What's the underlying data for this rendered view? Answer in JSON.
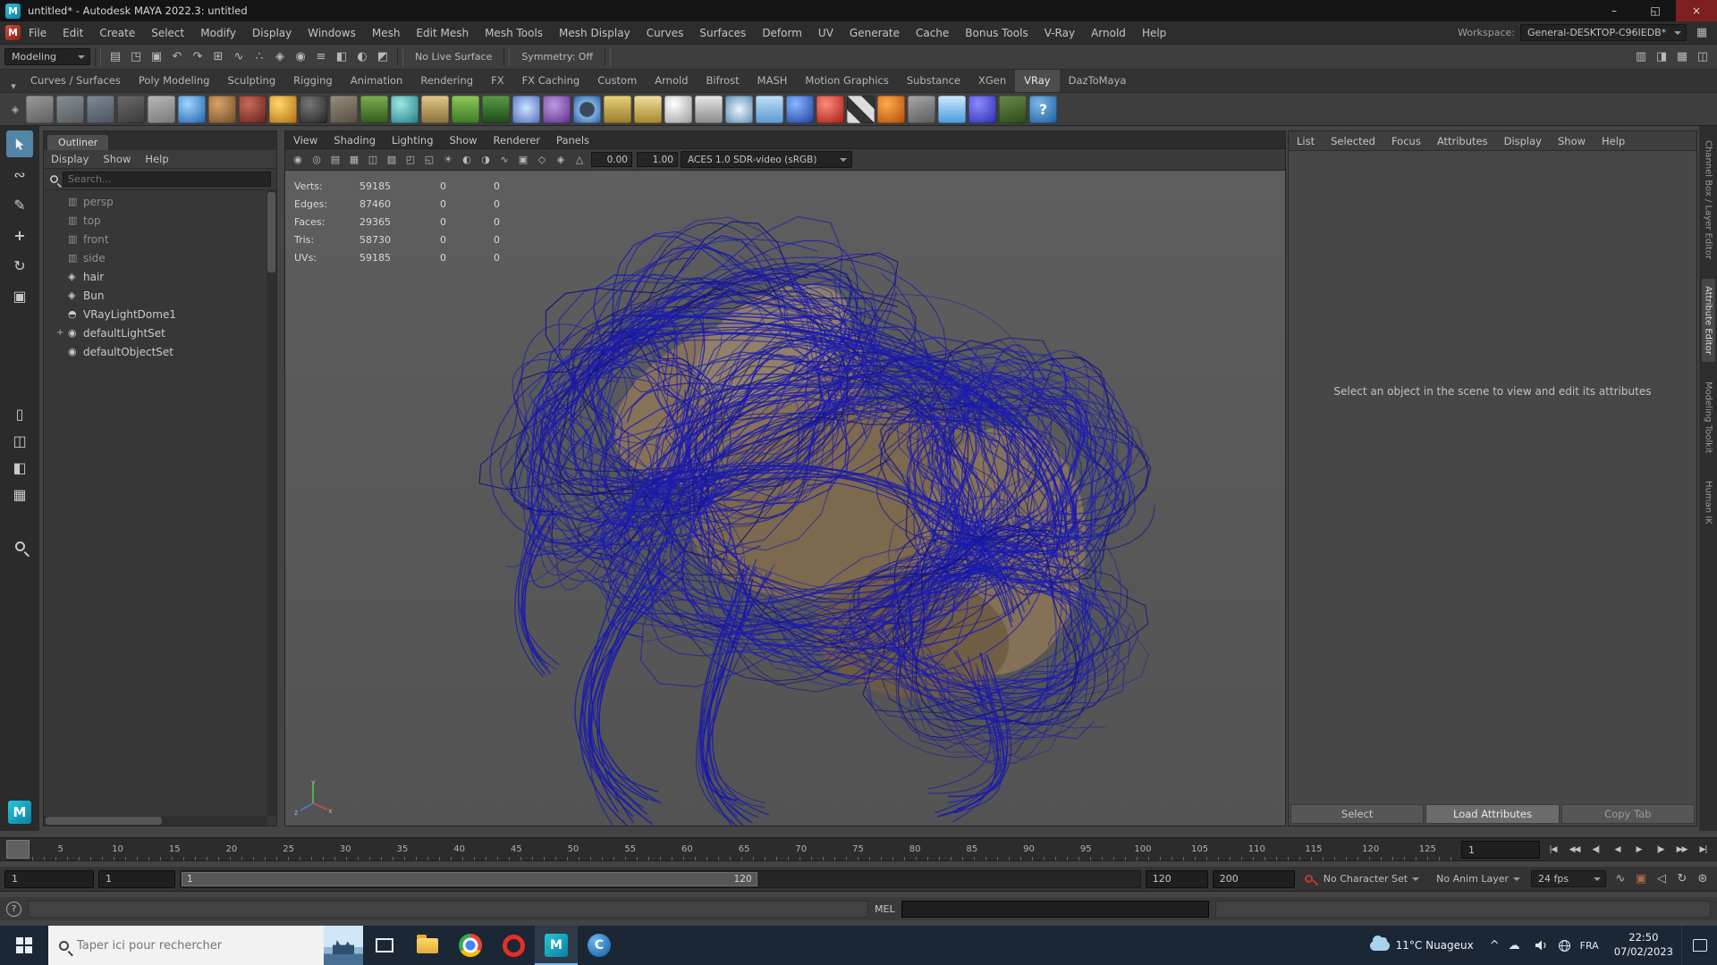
{
  "window": {
    "title": "untitled* - Autodesk MAYA 2022.3: untitled",
    "controls": [
      {
        "glyph": "–",
        "name": "minimize-button"
      },
      {
        "glyph": "◱",
        "name": "maximize-button"
      },
      {
        "glyph": "×",
        "name": "close-button"
      }
    ]
  },
  "logos": {
    "maya": "M",
    "c": "C"
  },
  "menubar": {
    "items": [
      "File",
      "Edit",
      "Create",
      "Select",
      "Modify",
      "Display",
      "Windows",
      "Mesh",
      "Edit Mesh",
      "Mesh Tools",
      "Mesh Display",
      "Curves",
      "Surfaces",
      "Deform",
      "UV",
      "Generate",
      "Cache",
      "Bonus Tools",
      "V-Ray",
      "Arnold",
      "Help"
    ],
    "workspace_label": "Workspace:",
    "workspace_value": "General-DESKTOP-C96IEDB*"
  },
  "statusline": {
    "mode": "Modeling",
    "icons_left": [
      {
        "glyph": "▤",
        "name": "new-scene-icon"
      },
      {
        "glyph": "◳",
        "name": "open-scene-icon"
      },
      {
        "glyph": "▣",
        "name": "save-scene-icon"
      },
      {
        "glyph": "↶",
        "name": "undo-icon"
      },
      {
        "glyph": "↷",
        "name": "redo-icon"
      },
      {
        "glyph": "⊞",
        "name": "snap-to-grid-icon"
      },
      {
        "glyph": "∿",
        "name": "snap-to-curve-icon"
      },
      {
        "glyph": "∴",
        "name": "snap-to-point-icon"
      },
      {
        "glyph": "◈",
        "name": "snap-to-plane-icon"
      },
      {
        "glyph": "◉",
        "name": "make-live-icon"
      },
      {
        "glyph": "≡",
        "name": "construction-history-icon"
      },
      {
        "glyph": "◧",
        "name": "render-icon"
      },
      {
        "glyph": "◐",
        "name": "ipr-render-icon"
      },
      {
        "glyph": "◩",
        "name": "render-settings-icon"
      }
    ],
    "no_live_surface": "No Live Surface",
    "symmetry": "Symmetry: Off",
    "icons_right": [
      {
        "glyph": "▥",
        "name": "sidebar-toggle-icon"
      },
      {
        "glyph": "◨",
        "name": "channel-box-toggle-icon"
      },
      {
        "glyph": "▦",
        "name": "modeling-toolkit-toggle-icon"
      },
      {
        "glyph": "◫",
        "name": "attribute-editor-toggle-icon"
      }
    ]
  },
  "shelf": {
    "tab_selector_glyph": "▾",
    "gear_glyph": "◈",
    "tabs": [
      {
        "label": "Curves / Surfaces"
      },
      {
        "label": "Poly Modeling"
      },
      {
        "label": "Sculpting"
      },
      {
        "label": "Rigging"
      },
      {
        "label": "Animation"
      },
      {
        "label": "Rendering"
      },
      {
        "label": "FX"
      },
      {
        "label": "FX Caching"
      },
      {
        "label": "Custom"
      },
      {
        "label": "Arnold"
      },
      {
        "label": "Bifrost"
      },
      {
        "label": "MASH"
      },
      {
        "label": "Motion Graphics"
      },
      {
        "label": "Substance"
      },
      {
        "label": "XGen"
      },
      {
        "label": "VRay",
        "bg": "#4d4d4d",
        "color": "#e9e9e9"
      },
      {
        "label": "DazToMaya"
      }
    ],
    "icons": [
      {
        "name": "poly-plane-icon",
        "bg": "linear-gradient(160deg,#9a9a9a,#5f5f5f)"
      },
      {
        "name": "uv-grid-icon",
        "bg": "linear-gradient(160deg,#8a8f94,#565b60)"
      },
      {
        "name": "panel-layout-icon",
        "bg": "linear-gradient(160deg,#7f8a94,#4a545e)"
      },
      {
        "name": "dropper-icon",
        "bg": "linear-gradient(160deg,#6a6a6a,#3a3a3a)"
      },
      {
        "name": "notes-icon",
        "bg": "linear-gradient(160deg,#b9b9b9,#787878)"
      },
      {
        "name": "earth-sphere-icon",
        "bg": "radial-gradient(circle at 35% 30%,#9fd4ff,#1d5fa8)"
      },
      {
        "name": "bronze-sphere-icon",
        "bg": "radial-gradient(circle at 35% 30%,#d8a46a,#6e4a22)"
      },
      {
        "name": "maroon-sphere-icon",
        "bg": "radial-gradient(circle at 35% 30%,#c86a5a,#5e1f18)"
      },
      {
        "name": "sun-sphere-icon",
        "bg": "radial-gradient(circle at 35% 30%,#ffd96a,#b06a10)"
      },
      {
        "name": "eclipse-sphere-icon",
        "bg": "radial-gradient(circle at 35% 30%,#777777,#222222)"
      },
      {
        "name": "rock-icon",
        "bg": "linear-gradient(160deg,#9a8f80,#544c40)"
      },
      {
        "name": "tree-icon",
        "bg": "linear-gradient(180deg,#7fae4f,#2e5a1f)"
      },
      {
        "name": "checker-sphere-icon",
        "bg": "radial-gradient(circle at 35% 30%,#9fe8e0,#1f7a8a)"
      },
      {
        "name": "straw-icon",
        "bg": "linear-gradient(180deg,#e0c98a,#8a6f3a)"
      },
      {
        "name": "grass-icon",
        "bg": "linear-gradient(180deg,#8fca5a,#3a7a22)"
      },
      {
        "name": "fern-icon",
        "bg": "linear-gradient(180deg,#5a9a4a,#1e4a18)"
      },
      {
        "name": "flower-icon",
        "bg": "radial-gradient(circle at 50% 45%,#cfe4ff,#4a6ab8)"
      },
      {
        "name": "swirl-icon",
        "bg": "radial-gradient(circle at 40% 35%,#c09ae0,#5a2a8a)"
      },
      {
        "name": "ring-icon",
        "bg": "radial-gradient(circle at 50% 50%,#3a4a5a 35%,#7ab0e0 42%,#2a5a9a)"
      },
      {
        "name": "dome-light-icon",
        "bg": "linear-gradient(180deg,#e8d27a,#9a7a2a)"
      },
      {
        "name": "glass-icon",
        "bg": "linear-gradient(180deg,#f0e0a0,#a8862a)"
      },
      {
        "name": "white-sphere-icon",
        "bg": "radial-gradient(circle at 35% 30%,#ffffff,#9a9a9a)"
      },
      {
        "name": "cone-icon",
        "bg": "linear-gradient(180deg,#e8e8e8,#8a8a8a)"
      },
      {
        "name": "snowflake-icon",
        "bg": "radial-gradient(circle at 50% 50%,#eaf6ff,#5a8ab0)"
      },
      {
        "name": "sky-icon",
        "bg": "linear-gradient(180deg,#bfe0f8,#5a9ad0)"
      },
      {
        "name": "blue-sphere-icon",
        "bg": "radial-gradient(circle at 35% 30%,#8ab8ff,#1a3a9a)"
      },
      {
        "name": "checker-ball-icon",
        "bg": "radial-gradient(circle at 35% 30%,#ff8a7a,#a01a10)"
      },
      {
        "name": "checker-bw-icon",
        "bg": "linear-gradient(45deg,#dddddd 25%,#333333 25% 50%,#dddddd 50% 75%,#333333 75%)"
      },
      {
        "name": "orange-ball-icon",
        "bg": "radial-gradient(circle at 35% 30%,#ffaa4a,#b04a08)"
      },
      {
        "name": "wrench-icon",
        "bg": "linear-gradient(160deg,#a8a8a8,#5a5a5a)"
      },
      {
        "name": "bifrost-cloud-icon",
        "bg": "linear-gradient(180deg,#cfe9ff,#4a9ae0)"
      },
      {
        "name": "vray-sphere-icon",
        "bg": "radial-gradient(circle at 35% 30%,#8a8aff,#2a2ab0)"
      },
      {
        "name": "xgen-icon",
        "bg": "linear-gradient(160deg,#6a8a4a,#2a4a1a)"
      },
      {
        "name": "help-shelf-icon",
        "bg": "radial-gradient(circle at 35% 30%,#7ab8e8,#1a5a9a)",
        "glyph": "?",
        "fg": "#ffffff"
      }
    ]
  },
  "tools": {
    "lasso": "∾",
    "paint": "✎",
    "move": "+",
    "rotate": "↻",
    "scale": "▣",
    "layouts": [
      {
        "glyph": "▯",
        "name": "layout-single-pane-button"
      },
      {
        "glyph": "◫",
        "name": "layout-two-pane-button"
      },
      {
        "glyph": "◧",
        "name": "layout-three-pane-button"
      },
      {
        "glyph": "▦",
        "name": "layout-four-pane-button"
      }
    ]
  },
  "outliner": {
    "tab": "Outliner",
    "menus": [
      "Display",
      "Show",
      "Help"
    ],
    "search_placeholder": "Search...",
    "items": [
      {
        "label": "persp",
        "glyph": "▥",
        "color": "#8f8f8f"
      },
      {
        "label": "top",
        "glyph": "▥",
        "color": "#8f8f8f"
      },
      {
        "label": "front",
        "glyph": "▥",
        "color": "#8f8f8f"
      },
      {
        "label": "side",
        "glyph": "▥",
        "color": "#8f8f8f"
      },
      {
        "label": "hair",
        "glyph": "◈",
        "color": "#cacaca"
      },
      {
        "label": "Bun",
        "glyph": "◈",
        "color": "#cacaca"
      },
      {
        "label": "VRayLightDome1",
        "glyph": "◓",
        "color": "#cacaca"
      },
      {
        "label": "defaultLightSet",
        "glyph": "◉",
        "color": "#cacaca",
        "expand": "+"
      },
      {
        "label": "defaultObjectSet",
        "glyph": "◉",
        "color": "#cacaca"
      }
    ]
  },
  "viewport": {
    "menus": [
      "View",
      "Shading",
      "Lighting",
      "Show",
      "Renderer",
      "Panels"
    ],
    "icons": [
      {
        "glyph": "◉",
        "name": "camera-icon"
      },
      {
        "glyph": "◎",
        "name": "lock-camera-icon"
      },
      {
        "glyph": "▤",
        "name": "film-gate-icon"
      },
      {
        "glyph": "▦",
        "name": "resolution-gate-icon"
      },
      {
        "glyph": "◫",
        "name": "gate-mask-icon"
      },
      {
        "glyph": "▧",
        "name": "field-chart-icon"
      },
      {
        "glyph": "◰",
        "name": "safe-action-icon"
      },
      {
        "glyph": "◱",
        "name": "safe-title-icon"
      },
      {
        "glyph": "☀",
        "name": "lighting-icon"
      },
      {
        "glyph": "◐",
        "name": "shadows-icon"
      },
      {
        "glyph": "◑",
        "name": "ambient-occlusion-icon"
      },
      {
        "glyph": "∿",
        "name": "motion-blur-icon"
      },
      {
        "glyph": "▣",
        "name": "multisample-icon"
      },
      {
        "glyph": "◇",
        "name": "depth-of-field-icon"
      },
      {
        "glyph": "◈",
        "name": "isolate-select-icon"
      },
      {
        "glyph": "△",
        "name": "xray-icon"
      }
    ],
    "exposure": "0.00",
    "gamma": "1.00",
    "colorspace": "ACES 1.0 SDR-video (sRGB)",
    "stats": [
      {
        "label": "Verts:",
        "value": "59185",
        "c1": "0",
        "c2": "0"
      },
      {
        "label": "Edges:",
        "value": "87460",
        "c1": "0",
        "c2": "0"
      },
      {
        "label": "Faces:",
        "value": "29365",
        "c1": "0",
        "c2": "0"
      },
      {
        "label": "Tris:",
        "value": "58730",
        "c1": "0",
        "c2": "0"
      },
      {
        "label": "UVs:",
        "value": "59185",
        "c1": "0",
        "c2": "0"
      }
    ],
    "axis": {
      "x": "x",
      "y": "y",
      "z": "z"
    }
  },
  "attribute_editor": {
    "menus": [
      "List",
      "Selected",
      "Focus",
      "Attributes",
      "Display",
      "Show",
      "Help"
    ],
    "empty_text": "Select an object in the scene to view and edit its attributes",
    "buttons": [
      {
        "label": "Select",
        "bg": "#565656",
        "color": "#c6c6c6"
      },
      {
        "label": "Load Attributes",
        "bg": "#6b6b6b",
        "color": "#e8e8e8"
      },
      {
        "label": "Copy Tab",
        "bg": "#565656",
        "color": "#9b9b9b"
      }
    ]
  },
  "right_tabs": [
    {
      "label": "Channel Box / Layer Editor"
    },
    {
      "label": "Attribute Editor",
      "bg": "#474747",
      "color": "#dedede"
    },
    {
      "label": "Modeling Toolkit"
    },
    {
      "label": "Human IK"
    }
  ],
  "timeline": {
    "ticks": [
      "5",
      "10",
      "15",
      "20",
      "25",
      "30",
      "35",
      "40",
      "45",
      "50",
      "55",
      "60",
      "65",
      "70",
      "75",
      "80",
      "85",
      "90",
      "95",
      "100",
      "105",
      "110",
      "115",
      "120",
      "125"
    ],
    "current_frame": "1",
    "playback": [
      {
        "glyph": "|◀",
        "name": "go-to-start-button"
      },
      {
        "glyph": "◀◀",
        "name": "step-back-frame-button"
      },
      {
        "glyph": "◀|",
        "name": "step-back-key-button"
      },
      {
        "glyph": "◀",
        "name": "play-backwards-button"
      },
      {
        "glyph": "▶",
        "name": "play-forward-button"
      },
      {
        "glyph": "|▶",
        "name": "step-forward-key-button"
      },
      {
        "glyph": "▶▶",
        "name": "step-forward-frame-button"
      },
      {
        "glyph": "▶|",
        "name": "go-to-end-button"
      }
    ]
  },
  "range": {
    "start": "1",
    "alt_start": "1",
    "bar_start": "1",
    "bar_end": "120",
    "end": "120",
    "scene_end": "200",
    "character_set": "No Character Set",
    "anim_layer": "No Anim Layer",
    "fps": "24 fps",
    "icons": [
      {
        "glyph": "∿",
        "name": "anim-preferences-icon",
        "color": "#b9b9b9"
      },
      {
        "glyph": "▣",
        "name": "cached-playback-icon",
        "color": "#b06a4a"
      },
      {
        "glyph": "◁",
        "name": "mute-icon",
        "color": "#b9b9b9"
      },
      {
        "glyph": "↻",
        "name": "playback-loop-icon",
        "color": "#b9b9b9"
      },
      {
        "glyph": "⊛",
        "name": "animation-settings-icon",
        "color": "#b9b9b9"
      }
    ]
  },
  "command_line": {
    "help_glyph": "?",
    "mel_label": "MEL"
  },
  "taskbar": {
    "search_placeholder": "Taper ici pour rechercher",
    "weather": "11°C Nuageux",
    "tray": [
      {
        "glyph": "^",
        "name": "chevron-up-icon"
      },
      {
        "glyph": "☁",
        "name": "onedrive-icon"
      }
    ],
    "lang": "FRA",
    "time": "22:50",
    "date": "07/02/2023"
  }
}
